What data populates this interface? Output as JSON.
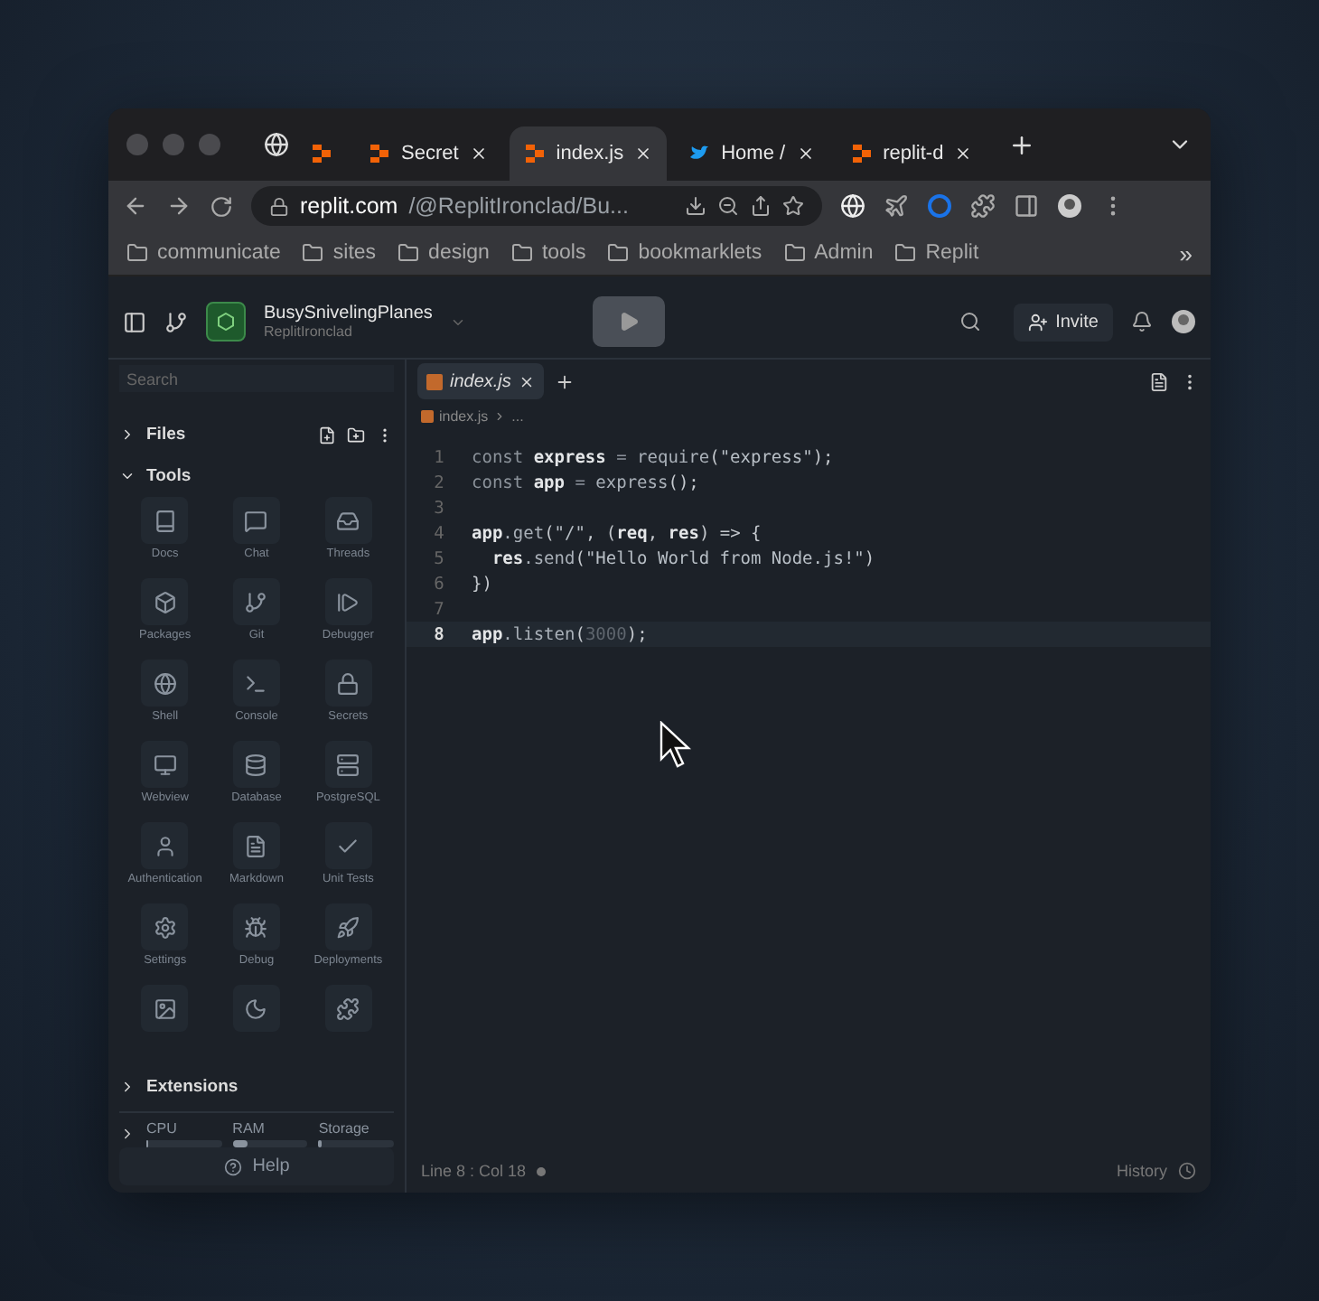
{
  "browser": {
    "tabs": [
      {
        "selected": false
      },
      {
        "label": "Secret",
        "selected": false
      },
      {
        "label": "index.js",
        "selected": true
      },
      {
        "label": "Home /",
        "selected": false
      },
      {
        "label": "replit-d",
        "selected": false
      }
    ],
    "url": {
      "host": "replit.com",
      "path": "/@ReplitIronclad/Bu..."
    },
    "bookmarks": [
      "communicate",
      "sites",
      "design",
      "tools",
      "bookmarklets",
      "Admin",
      "Replit"
    ],
    "bookmarks_more": "»"
  },
  "header": {
    "project": "BusySnivelingPlanes",
    "owner": "ReplitIronclad",
    "invite": "Invite"
  },
  "sidebar": {
    "search": {
      "placeholder": "Search"
    },
    "sections": [
      {
        "label": "Files",
        "expanded": false
      },
      {
        "label": "Tools",
        "expanded": true
      }
    ],
    "tools": [
      {
        "kind": "labeled",
        "label": "Docs"
      },
      {
        "kind": "labeled",
        "label": "Chat"
      },
      {
        "kind": "labeled",
        "label": "Threads"
      },
      {
        "kind": "labeled",
        "label": "Packages"
      },
      {
        "kind": "labeled",
        "label": "Git"
      },
      {
        "kind": "labeled",
        "label": "Debugger"
      },
      {
        "kind": "labeled",
        "label": "Shell"
      },
      {
        "kind": "labeled",
        "label": "Console"
      },
      {
        "kind": "labeled",
        "label": "Secrets"
      },
      {
        "kind": "labeled",
        "label": "Webview"
      },
      {
        "kind": "labeled",
        "label": "Database"
      },
      {
        "kind": "labeled",
        "label": "PostgreSQL"
      },
      {
        "kind": "labeled",
        "label": "Authentication"
      },
      {
        "kind": "labeled",
        "label": "Markdown"
      },
      {
        "kind": "labeled",
        "label": "Unit Tests"
      },
      {
        "kind": "labeled",
        "label": "Settings"
      },
      {
        "kind": "labeled",
        "label": "Debug"
      },
      {
        "kind": "labeled",
        "label": "Deployments"
      },
      {
        "kind": "icon_only"
      },
      {
        "kind": "icon_only"
      },
      {
        "kind": "icon_only"
      }
    ],
    "extensions": {
      "label": "Extensions",
      "expanded": false
    },
    "resources": [
      {
        "name": "CPU",
        "level": 0.02
      },
      {
        "name": "RAM",
        "level": 0.2
      },
      {
        "name": "Storage",
        "level": 0.03
      }
    ],
    "help": "Help"
  },
  "editor": {
    "tabs": [
      {
        "label": "index.js",
        "selected": true
      }
    ],
    "breadcrumb": [
      "index.js",
      "..."
    ],
    "lines": [
      {
        "number": "1",
        "active": false,
        "indented": false,
        "tokens": [
          {
            "kind": "kw",
            "text": "const "
          },
          {
            "kind": "var",
            "text": "express"
          },
          {
            "kind": "kw",
            "text": " = "
          },
          {
            "kind": "fn",
            "text": "require"
          },
          {
            "kind": "punc",
            "text": "("
          },
          {
            "kind": "str",
            "text": "\"express\""
          },
          {
            "kind": "punc",
            "text": ");"
          }
        ]
      },
      {
        "number": "2",
        "active": false,
        "indented": false,
        "tokens": [
          {
            "kind": "kw",
            "text": "const "
          },
          {
            "kind": "var",
            "text": "app"
          },
          {
            "kind": "kw",
            "text": " = "
          },
          {
            "kind": "fn",
            "text": "express"
          },
          {
            "kind": "punc",
            "text": "();"
          }
        ]
      },
      {
        "number": "3",
        "active": false
      },
      {
        "number": "4",
        "active": false,
        "indented": false,
        "tokens": [
          {
            "kind": "var",
            "text": "app"
          },
          {
            "kind": "fn",
            "text": ".get"
          },
          {
            "kind": "punc",
            "text": "("
          },
          {
            "kind": "str",
            "text": "\"/\""
          },
          {
            "kind": "punc",
            "text": ", ("
          },
          {
            "kind": "var",
            "text": "req"
          },
          {
            "kind": "punc",
            "text": ", "
          },
          {
            "kind": "var",
            "text": "res"
          },
          {
            "kind": "punc",
            "text": ") => {"
          }
        ]
      },
      {
        "number": "5",
        "active": false,
        "indented": true,
        "tokens": [
          {
            "kind": "var",
            "text": "res"
          },
          {
            "kind": "fn",
            "text": ".send"
          },
          {
            "kind": "punc",
            "text": "("
          },
          {
            "kind": "str",
            "text": "\"Hello World from Node.js!\""
          },
          {
            "kind": "punc",
            "text": ")"
          }
        ]
      },
      {
        "number": "6",
        "active": false,
        "indented": false,
        "tokens": [
          {
            "kind": "punc",
            "text": "})"
          }
        ]
      },
      {
        "number": "7",
        "active": false
      },
      {
        "number": "8",
        "active": true,
        "indented": false,
        "tokens": [
          {
            "kind": "var",
            "text": "app"
          },
          {
            "kind": "fn",
            "text": ".listen"
          },
          {
            "kind": "punc",
            "text": "("
          },
          {
            "kind": "num",
            "text": "3000"
          },
          {
            "kind": "punc",
            "text": ");"
          }
        ]
      }
    ],
    "status": {
      "position": "Line 8 : Col 18",
      "history": "History"
    }
  }
}
